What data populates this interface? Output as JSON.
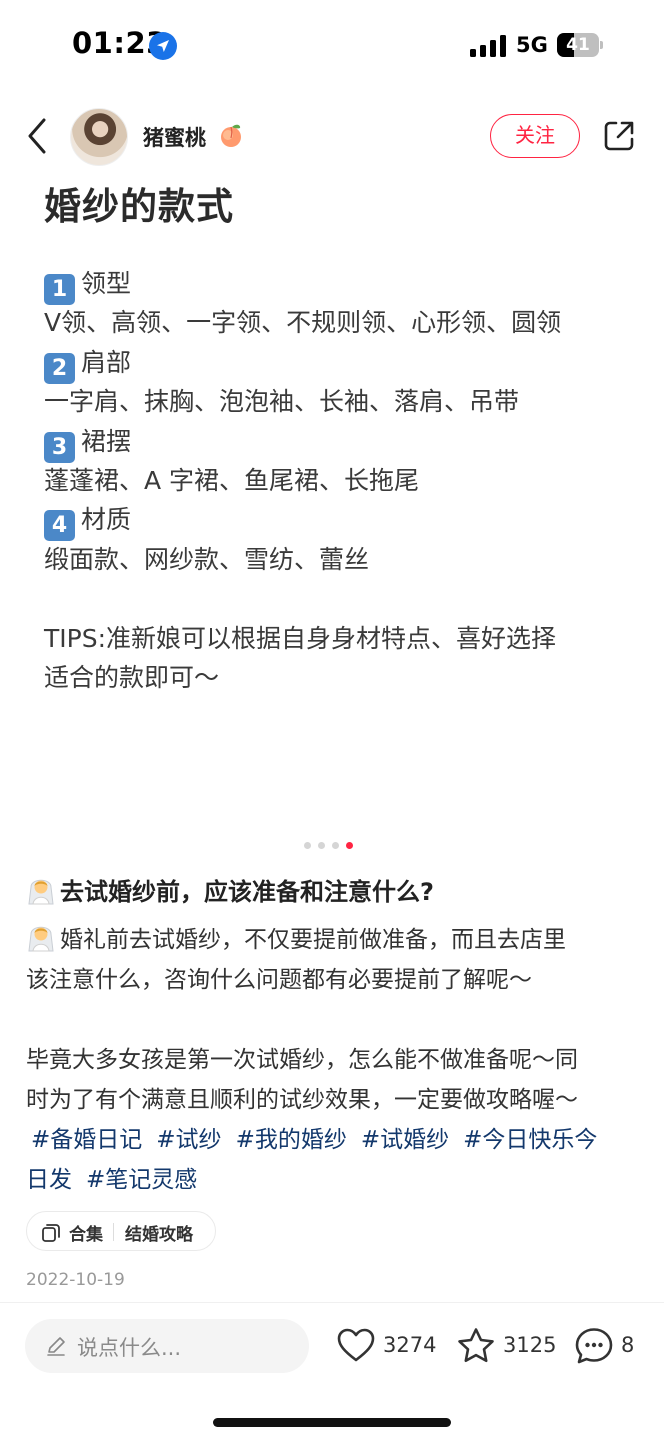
{
  "status_bar": {
    "time": "01:23",
    "network": "5G",
    "battery_level": "41",
    "battery_fraction": 0.41,
    "icons": [
      "location-arrow-icon",
      "signal-bars-icon",
      "battery-icon"
    ]
  },
  "header": {
    "username": "猪蜜桃",
    "username_emoji": "peach-icon",
    "follow_label": "关注",
    "back_icon": "chevron-left-icon",
    "share_icon": "share-icon",
    "accent_color": "#ff2442"
  },
  "slide": {
    "title": "婚纱的款式",
    "sections": [
      {
        "num": "1",
        "heading": "领型",
        "items": "V领、高领、一字领、不规则领、心形领、圆领"
      },
      {
        "num": "2",
        "heading": "肩部",
        "items": "一字肩、抹胸、泡泡袖、长袖、落肩、吊带"
      },
      {
        "num": "3",
        "heading": "裙摆",
        "items": "蓬蓬裙、A 字裙、鱼尾裙、长拖尾"
      },
      {
        "num": "4",
        "heading": "材质",
        "items": "缎面款、网纱款、雪纺、蕾丝"
      }
    ],
    "tips_line1": "TIPS:准新娘可以根据自身身材特点、喜好选择",
    "tips_line2": "适合的款即可～",
    "page_count": 4,
    "current_page": 4
  },
  "note": {
    "title": "去试婚纱前，应该准备和注意什么?",
    "para1_line1": "婚礼前去试婚纱，不仅要提前做准备，而且去店里",
    "para1_line2": "该注意什么，咨询什么问题都有必要提前了解呢～",
    "para2_line1": "毕竟大多女孩是第一次试婚纱，怎么能不做准备呢～同",
    "para2_line2": "时为了有个满意且顺利的试纱效果，一定要做攻略喔～",
    "tags": [
      "#备婚日记",
      "#试纱",
      "#我的婚纱",
      "#试婚纱",
      "#今日快乐今",
      "日发",
      "#笔记灵感"
    ],
    "tag_color": "#13386c",
    "collection_label": "合集",
    "collection_name": "结婚攻略",
    "date": "2022-10-19"
  },
  "bottom_bar": {
    "comment_placeholder": "说点什么...",
    "likes": "3274",
    "stars": "3125",
    "comments": "8"
  }
}
